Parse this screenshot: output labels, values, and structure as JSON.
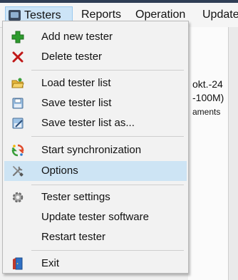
{
  "menubar": {
    "items": [
      {
        "label": "Testers"
      },
      {
        "label": "Reports"
      },
      {
        "label": "Operation"
      },
      {
        "label": "Update"
      }
    ]
  },
  "background": {
    "lines": [
      "okt.-24",
      "-100M)",
      "aments"
    ]
  },
  "dropdown": {
    "items": [
      {
        "label": "Add new tester",
        "icon": "plus-icon"
      },
      {
        "label": "Delete tester",
        "icon": "x-icon"
      },
      {
        "label": "Load tester list",
        "icon": "folder-open-icon"
      },
      {
        "label": "Save tester list",
        "icon": "save-icon"
      },
      {
        "label": "Save tester list as...",
        "icon": "save-as-icon"
      },
      {
        "label": "Start synchronization",
        "icon": "sync-icon"
      },
      {
        "label": "Options",
        "icon": "tools-icon"
      },
      {
        "label": "Tester settings",
        "icon": "gear-icon"
      },
      {
        "label": "Update tester software",
        "icon": ""
      },
      {
        "label": "Restart tester",
        "icon": ""
      },
      {
        "label": "Exit",
        "icon": "exit-door-icon"
      }
    ],
    "highlighted_index": 6
  },
  "colors": {
    "highlight": "#cde4f4",
    "menubar_active": "#cce4f7",
    "plus_green": "#2e9b2e",
    "delete_red": "#c01818"
  }
}
